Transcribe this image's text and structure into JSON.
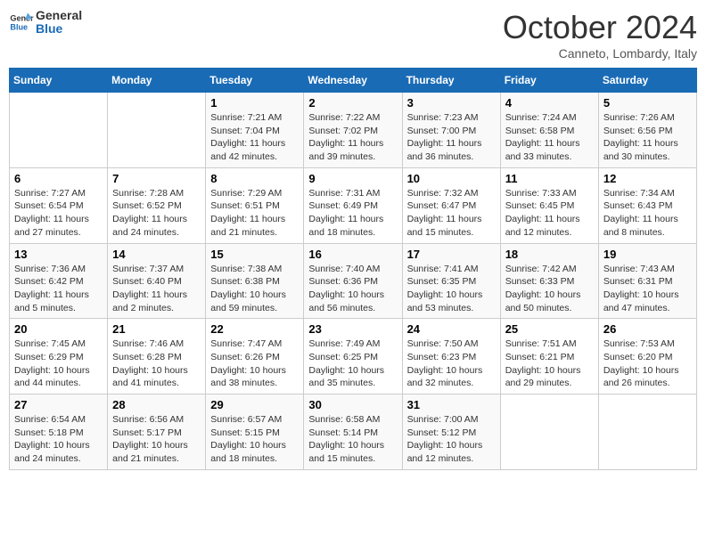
{
  "logo": {
    "line1": "General",
    "line2": "Blue"
  },
  "title": "October 2024",
  "subtitle": "Canneto, Lombardy, Italy",
  "days_header": [
    "Sunday",
    "Monday",
    "Tuesday",
    "Wednesday",
    "Thursday",
    "Friday",
    "Saturday"
  ],
  "weeks": [
    [
      {
        "num": "",
        "detail": ""
      },
      {
        "num": "",
        "detail": ""
      },
      {
        "num": "1",
        "detail": "Sunrise: 7:21 AM\nSunset: 7:04 PM\nDaylight: 11 hours and 42 minutes."
      },
      {
        "num": "2",
        "detail": "Sunrise: 7:22 AM\nSunset: 7:02 PM\nDaylight: 11 hours and 39 minutes."
      },
      {
        "num": "3",
        "detail": "Sunrise: 7:23 AM\nSunset: 7:00 PM\nDaylight: 11 hours and 36 minutes."
      },
      {
        "num": "4",
        "detail": "Sunrise: 7:24 AM\nSunset: 6:58 PM\nDaylight: 11 hours and 33 minutes."
      },
      {
        "num": "5",
        "detail": "Sunrise: 7:26 AM\nSunset: 6:56 PM\nDaylight: 11 hours and 30 minutes."
      }
    ],
    [
      {
        "num": "6",
        "detail": "Sunrise: 7:27 AM\nSunset: 6:54 PM\nDaylight: 11 hours and 27 minutes."
      },
      {
        "num": "7",
        "detail": "Sunrise: 7:28 AM\nSunset: 6:52 PM\nDaylight: 11 hours and 24 minutes."
      },
      {
        "num": "8",
        "detail": "Sunrise: 7:29 AM\nSunset: 6:51 PM\nDaylight: 11 hours and 21 minutes."
      },
      {
        "num": "9",
        "detail": "Sunrise: 7:31 AM\nSunset: 6:49 PM\nDaylight: 11 hours and 18 minutes."
      },
      {
        "num": "10",
        "detail": "Sunrise: 7:32 AM\nSunset: 6:47 PM\nDaylight: 11 hours and 15 minutes."
      },
      {
        "num": "11",
        "detail": "Sunrise: 7:33 AM\nSunset: 6:45 PM\nDaylight: 11 hours and 12 minutes."
      },
      {
        "num": "12",
        "detail": "Sunrise: 7:34 AM\nSunset: 6:43 PM\nDaylight: 11 hours and 8 minutes."
      }
    ],
    [
      {
        "num": "13",
        "detail": "Sunrise: 7:36 AM\nSunset: 6:42 PM\nDaylight: 11 hours and 5 minutes."
      },
      {
        "num": "14",
        "detail": "Sunrise: 7:37 AM\nSunset: 6:40 PM\nDaylight: 11 hours and 2 minutes."
      },
      {
        "num": "15",
        "detail": "Sunrise: 7:38 AM\nSunset: 6:38 PM\nDaylight: 10 hours and 59 minutes."
      },
      {
        "num": "16",
        "detail": "Sunrise: 7:40 AM\nSunset: 6:36 PM\nDaylight: 10 hours and 56 minutes."
      },
      {
        "num": "17",
        "detail": "Sunrise: 7:41 AM\nSunset: 6:35 PM\nDaylight: 10 hours and 53 minutes."
      },
      {
        "num": "18",
        "detail": "Sunrise: 7:42 AM\nSunset: 6:33 PM\nDaylight: 10 hours and 50 minutes."
      },
      {
        "num": "19",
        "detail": "Sunrise: 7:43 AM\nSunset: 6:31 PM\nDaylight: 10 hours and 47 minutes."
      }
    ],
    [
      {
        "num": "20",
        "detail": "Sunrise: 7:45 AM\nSunset: 6:29 PM\nDaylight: 10 hours and 44 minutes."
      },
      {
        "num": "21",
        "detail": "Sunrise: 7:46 AM\nSunset: 6:28 PM\nDaylight: 10 hours and 41 minutes."
      },
      {
        "num": "22",
        "detail": "Sunrise: 7:47 AM\nSunset: 6:26 PM\nDaylight: 10 hours and 38 minutes."
      },
      {
        "num": "23",
        "detail": "Sunrise: 7:49 AM\nSunset: 6:25 PM\nDaylight: 10 hours and 35 minutes."
      },
      {
        "num": "24",
        "detail": "Sunrise: 7:50 AM\nSunset: 6:23 PM\nDaylight: 10 hours and 32 minutes."
      },
      {
        "num": "25",
        "detail": "Sunrise: 7:51 AM\nSunset: 6:21 PM\nDaylight: 10 hours and 29 minutes."
      },
      {
        "num": "26",
        "detail": "Sunrise: 7:53 AM\nSunset: 6:20 PM\nDaylight: 10 hours and 26 minutes."
      }
    ],
    [
      {
        "num": "27",
        "detail": "Sunrise: 6:54 AM\nSunset: 5:18 PM\nDaylight: 10 hours and 24 minutes."
      },
      {
        "num": "28",
        "detail": "Sunrise: 6:56 AM\nSunset: 5:17 PM\nDaylight: 10 hours and 21 minutes."
      },
      {
        "num": "29",
        "detail": "Sunrise: 6:57 AM\nSunset: 5:15 PM\nDaylight: 10 hours and 18 minutes."
      },
      {
        "num": "30",
        "detail": "Sunrise: 6:58 AM\nSunset: 5:14 PM\nDaylight: 10 hours and 15 minutes."
      },
      {
        "num": "31",
        "detail": "Sunrise: 7:00 AM\nSunset: 5:12 PM\nDaylight: 10 hours and 12 minutes."
      },
      {
        "num": "",
        "detail": ""
      },
      {
        "num": "",
        "detail": ""
      }
    ]
  ]
}
